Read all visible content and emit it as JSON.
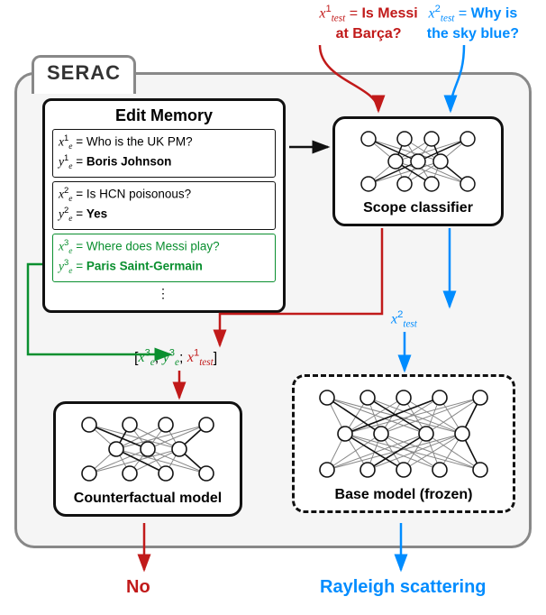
{
  "inputs": {
    "x1": {
      "var": "x",
      "sub": "test",
      "sup": "1",
      "eq": " = ",
      "l1": "Is Messi",
      "l2": "at Barça?"
    },
    "x2": {
      "var": "x",
      "sub": "test",
      "sup": "2",
      "eq": " = ",
      "l1": "Why is",
      "l2": "the sky blue?"
    }
  },
  "serac": {
    "title": "SERAC"
  },
  "editMemory": {
    "title": "Edit Memory",
    "entries": [
      {
        "x": {
          "var": "x",
          "sub": "e",
          "sup": "1",
          "eq": " = ",
          "text": "Who is the UK PM?"
        },
        "y": {
          "var": "y",
          "sub": "e",
          "sup": "1",
          "eq": " = ",
          "text": "Boris Johnson"
        },
        "color": "black"
      },
      {
        "x": {
          "var": "x",
          "sub": "e",
          "sup": "2",
          "eq": " = ",
          "text": "Is HCN poisonous?"
        },
        "y": {
          "var": "y",
          "sub": "e",
          "sup": "2",
          "eq": " = ",
          "text": "Yes"
        },
        "color": "black"
      },
      {
        "x": {
          "var": "x",
          "sub": "e",
          "sup": "3",
          "eq": " = ",
          "text": "Where does Messi play?"
        },
        "y": {
          "var": "y",
          "sub": "e",
          "sup": "3",
          "eq": " = ",
          "text": "Paris Saint-Germain"
        },
        "color": "green"
      }
    ],
    "ellipsis": "⋮"
  },
  "concat": {
    "open": "[",
    "sep": "; ",
    "close": "]",
    "t1": {
      "var": "x",
      "sub": "e",
      "sup": "3"
    },
    "t2": {
      "var": "y",
      "sub": "e",
      "sup": "3"
    },
    "t3": {
      "var": "x",
      "sub": "test",
      "sup": "1"
    }
  },
  "passThrough": {
    "var": "x",
    "sub": "test",
    "sup": "2"
  },
  "blocks": {
    "scope": "Scope classifier",
    "cf": "Counterfactual model",
    "base": "Base model (frozen)"
  },
  "outputs": {
    "left": "No",
    "right": "Rayleigh scattering"
  }
}
